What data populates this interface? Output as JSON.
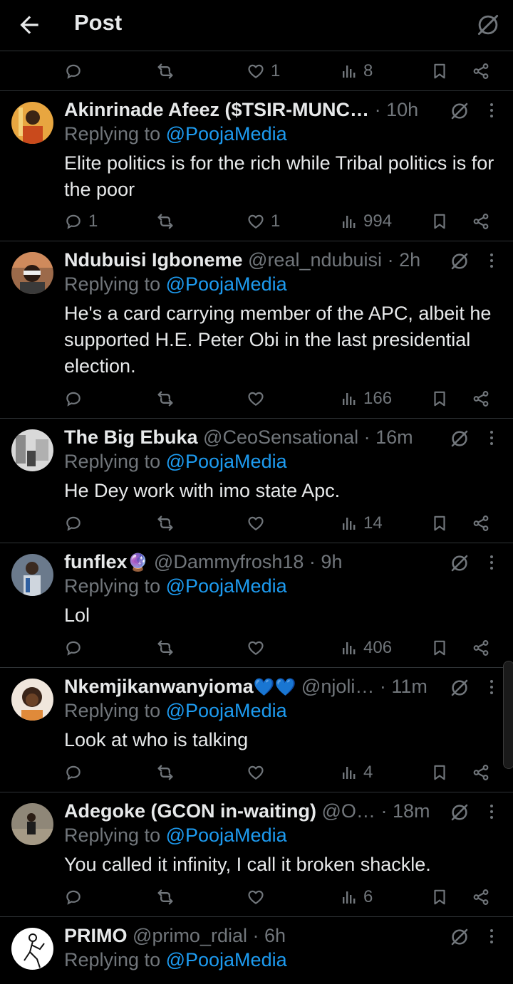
{
  "header": {
    "title": "Post"
  },
  "first_actions": {
    "replies": "",
    "reposts": "",
    "likes": "1",
    "views": "8"
  },
  "tweets": [
    {
      "name": "Akinrinade Afeez ($TSIR-MUNC…",
      "handle": "",
      "dot": "·",
      "time": "10h",
      "reply_prefix": "Replying to ",
      "mention": "@PoojaMedia",
      "text": "Elite politics is for the rich while Tribal politics is for the poor",
      "replies": "1",
      "reposts": "",
      "likes": "1",
      "views": "994"
    },
    {
      "name": "Ndubuisi Igboneme",
      "handle": "@real_ndubuisi",
      "dot": "·",
      "time": "2h",
      "reply_prefix": "Replying to ",
      "mention": "@PoojaMedia",
      "text": "He's a card carrying member of the APC, albeit he supported H.E. Peter Obi in the last presidential election.",
      "replies": "",
      "reposts": "",
      "likes": "",
      "views": "166"
    },
    {
      "name": "The Big Ebuka",
      "handle": "@CeoSensational",
      "dot": "·",
      "time": "16m",
      "reply_prefix": "Replying to ",
      "mention": "@PoojaMedia",
      "text": "He Dey work with imo state Apc.",
      "replies": "",
      "reposts": "",
      "likes": "",
      "views": "14"
    },
    {
      "name": "funflex",
      "emoji": "🔮",
      "handle": "@Dammyfrosh18",
      "dot": "·",
      "time": "9h",
      "reply_prefix": "Replying to ",
      "mention": "@PoojaMedia",
      "text": "Lol",
      "replies": "",
      "reposts": "",
      "likes": "",
      "views": "406"
    },
    {
      "name": "Nkemjikanwanyioma",
      "emoji": "💙💙",
      "handle": "@njoli…",
      "dot": "·",
      "time": "11m",
      "reply_prefix": "Replying to ",
      "mention": "@PoojaMedia",
      "text": "Look at who is talking",
      "replies": "",
      "reposts": "",
      "likes": "",
      "views": "4"
    },
    {
      "name": "Adegoke (GCON in-waiting)",
      "handle": "@O…",
      "dot": "·",
      "time": "18m",
      "reply_prefix": "Replying to ",
      "mention": "@PoojaMedia",
      "text": "You called it infinity, I call it broken shackle.",
      "replies": "",
      "reposts": "",
      "likes": "",
      "views": "6"
    },
    {
      "name": "PRIMO",
      "handle": "@primo_rdial",
      "dot": "·",
      "time": "6h",
      "reply_prefix": "Replying to ",
      "mention": "@PoojaMedia",
      "text": "",
      "replies": "",
      "reposts": "",
      "likes": "",
      "views": ""
    }
  ],
  "colors": {
    "background": "#000000",
    "text": "#e7e9ea",
    "secondary": "#71767b",
    "link": "#1d9bf0",
    "divider": "#2f3336"
  },
  "icons": [
    "back-arrow-icon",
    "grok-icon",
    "more-icon",
    "reply-icon",
    "repost-icon",
    "like-icon",
    "views-icon",
    "bookmark-icon",
    "share-icon"
  ]
}
